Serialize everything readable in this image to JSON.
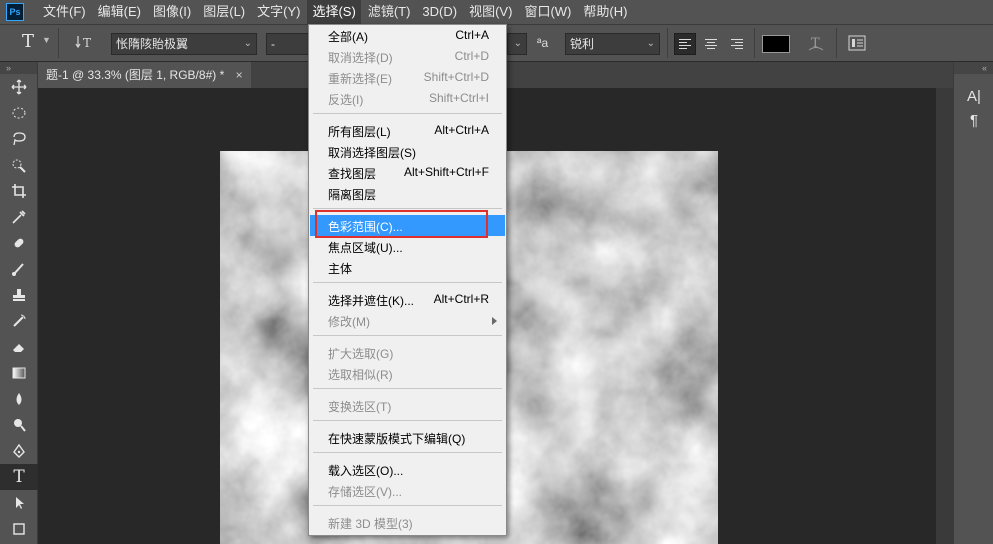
{
  "menubar": {
    "logo": "Ps",
    "items": [
      "文件(F)",
      "编辑(E)",
      "图像(I)",
      "图层(L)",
      "文字(Y)",
      "选择(S)",
      "滤镜(T)",
      "3D(D)",
      "视图(V)",
      "窗口(W)",
      "帮助(H)"
    ],
    "active_index": 5
  },
  "options": {
    "tool_letter": "T",
    "font_family": "怅隋陔貽极翼",
    "font_style": "-",
    "aa_symbol": "ªa",
    "antialias": "锐利",
    "color": "#000000"
  },
  "document_tab": {
    "title": "题-1 @ 33.3% (图层 1, RGB/8#) *",
    "close": "×"
  },
  "right_panel": {
    "char_glyph": "A|",
    "para_glyph": "¶"
  },
  "select_menu": {
    "items": [
      {
        "label": "全部(A)",
        "shortcut": "Ctrl+A",
        "disabled": false
      },
      {
        "label": "取消选择(D)",
        "shortcut": "Ctrl+D",
        "disabled": true
      },
      {
        "label": "重新选择(E)",
        "shortcut": "Shift+Ctrl+D",
        "disabled": true
      },
      {
        "label": "反选(I)",
        "shortcut": "Shift+Ctrl+I",
        "disabled": true
      },
      {
        "label": "所有图层(L)",
        "shortcut": "Alt+Ctrl+A",
        "disabled": false
      },
      {
        "label": "取消选择图层(S)",
        "shortcut": "",
        "disabled": false
      },
      {
        "label": "查找图层",
        "shortcut": "Alt+Shift+Ctrl+F",
        "disabled": false
      },
      {
        "label": "隔离图层",
        "shortcut": "",
        "disabled": false
      },
      {
        "label": "色彩范围(C)...",
        "shortcut": "",
        "disabled": false,
        "highlighted": true
      },
      {
        "label": "焦点区域(U)...",
        "shortcut": "",
        "disabled": false
      },
      {
        "label": "主体",
        "shortcut": "",
        "disabled": false
      },
      {
        "label": "选择并遮住(K)...",
        "shortcut": "Alt+Ctrl+R",
        "disabled": false
      },
      {
        "label": "修改(M)",
        "shortcut": "",
        "disabled": true,
        "submenu": true
      },
      {
        "label": "扩大选取(G)",
        "shortcut": "",
        "disabled": true
      },
      {
        "label": "选取相似(R)",
        "shortcut": "",
        "disabled": true
      },
      {
        "label": "变换选区(T)",
        "shortcut": "",
        "disabled": true
      },
      {
        "label": "在快速蒙版模式下编辑(Q)",
        "shortcut": "",
        "disabled": false
      },
      {
        "label": "载入选区(O)...",
        "shortcut": "",
        "disabled": false
      },
      {
        "label": "存储选区(V)...",
        "shortcut": "",
        "disabled": true
      },
      {
        "label": "新建 3D 模型(3)",
        "shortcut": "",
        "disabled": true
      }
    ]
  },
  "tools": [
    "move-tool",
    "marquee-tool",
    "lasso-tool",
    "quick-select-tool",
    "crop-tool",
    "eyedropper-tool",
    "healing-tool",
    "brush-tool",
    "stamp-tool",
    "history-brush-tool",
    "eraser-tool",
    "gradient-tool",
    "blur-tool",
    "dodge-tool",
    "pen-tool",
    "type-tool",
    "path-select-tool"
  ],
  "colors": {
    "highlight": "#3399ff",
    "annotation_box": "#e0302b",
    "ui_panel": "#535353"
  }
}
